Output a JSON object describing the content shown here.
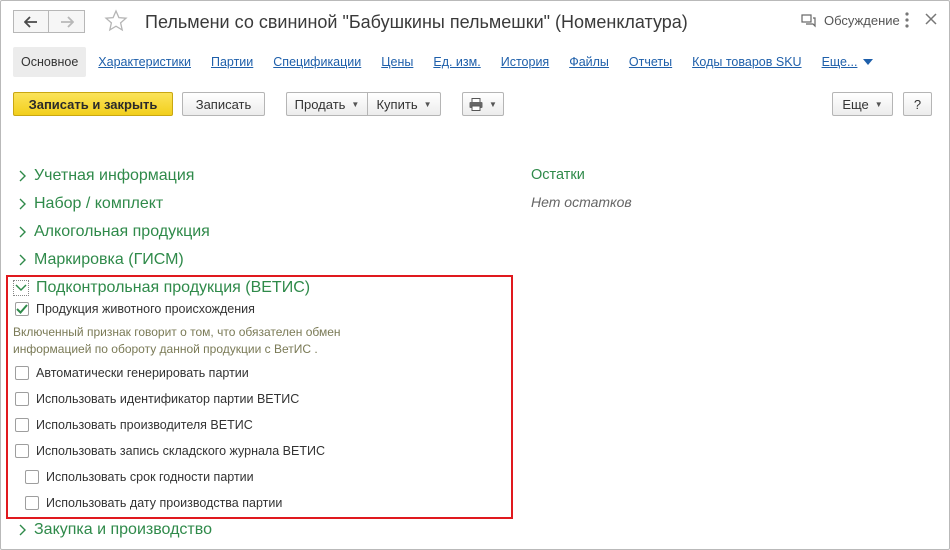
{
  "window": {
    "title": "Пельмени со свининой \"Бабушкины пельмешки\" (Номенклатура)",
    "discussion_label": "Обсуждение"
  },
  "tabs": [
    {
      "label": "Основное",
      "active": true
    },
    {
      "label": "Характеристики"
    },
    {
      "label": "Партии"
    },
    {
      "label": "Спецификации"
    },
    {
      "label": "Цены"
    },
    {
      "label": "Ед. изм."
    },
    {
      "label": "История"
    },
    {
      "label": "Файлы"
    },
    {
      "label": "Отчеты"
    },
    {
      "label": "Коды товаров SKU"
    },
    {
      "label": "Еще..."
    }
  ],
  "toolbar": {
    "save_close_label": "Записать и закрыть",
    "save_label": "Записать",
    "sell_label": "Продать",
    "buy_label": "Купить",
    "more_label": "Еще",
    "help_label": "?"
  },
  "sections": [
    {
      "label": "Учетная информация"
    },
    {
      "label": "Набор / комплект"
    },
    {
      "label": "Алкогольная продукция"
    },
    {
      "label": "Маркировка (ГИСМ)"
    },
    {
      "label": "Подконтрольная продукция (ВЕТИС)"
    },
    {
      "label": "Закупка и производство"
    }
  ],
  "vetis": {
    "animal_origin_label": "Продукция животного происхождения",
    "animal_origin_checked": true,
    "hint_line1": "Включенный признак говорит о том, что обязателен обмен",
    "hint_line2": "информацией по обороту данной продукции с ВетИС .",
    "options": [
      {
        "label": "Автоматически генерировать партии",
        "checked": false
      },
      {
        "label": "Использовать идентификатор партии ВЕТИС",
        "checked": false
      },
      {
        "label": "Использовать производителя ВЕТИС",
        "checked": false
      },
      {
        "label": "Использовать запись складского журнала ВЕТИС",
        "checked": false
      },
      {
        "label": "Использовать срок годности партии",
        "checked": false
      },
      {
        "label": "Использовать дату производства партии",
        "checked": false
      }
    ]
  },
  "stock": {
    "title": "Остатки",
    "empty_text": "Нет остатков"
  },
  "colors": {
    "accent_green": "#2f8a4a",
    "link_blue": "#1e5faa",
    "primary_yellow": "#f2cf1c",
    "highlight_red": "#e0191e"
  }
}
